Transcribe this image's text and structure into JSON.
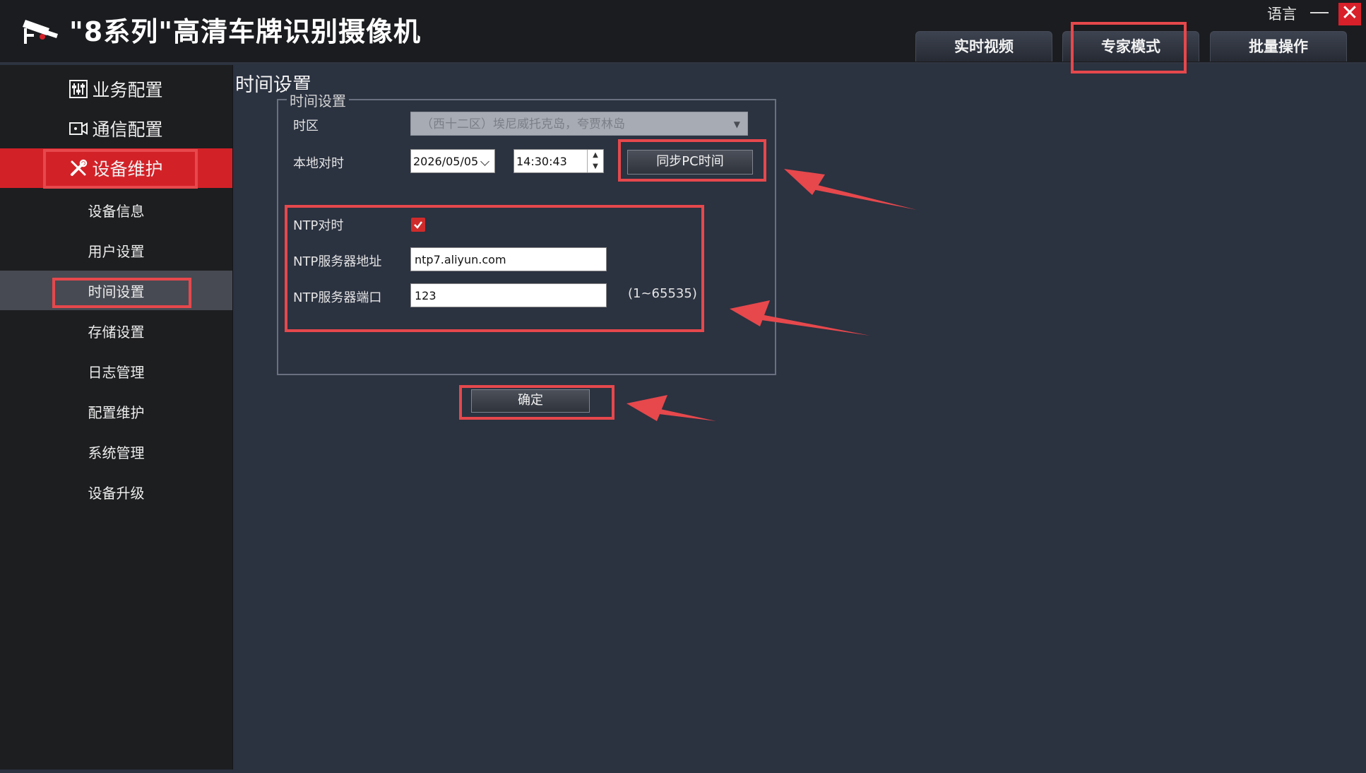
{
  "app": {
    "title": "\"8系列\"高清车牌识别摄像机",
    "language_label": "语言",
    "close_glyph": "✕"
  },
  "top_tabs": [
    {
      "label": "实时视频"
    },
    {
      "label": "专家模式"
    },
    {
      "label": "批量操作"
    }
  ],
  "sidebar": {
    "main_items": [
      {
        "label": "业务配置",
        "icon": "sliders-icon"
      },
      {
        "label": "通信配置",
        "icon": "camera-icon"
      },
      {
        "label": "设备维护",
        "icon": "tools-icon",
        "active": true
      }
    ],
    "sub_items": [
      {
        "label": "设备信息"
      },
      {
        "label": "用户设置"
      },
      {
        "label": "时间设置",
        "active": true
      },
      {
        "label": "存储设置"
      },
      {
        "label": "日志管理"
      },
      {
        "label": "配置维护"
      },
      {
        "label": "系统管理"
      },
      {
        "label": "设备升级"
      }
    ]
  },
  "main": {
    "page_title": "时间设置",
    "group_title": "时间设置",
    "timezone": {
      "label": "时区",
      "value": "（西十二区）埃尼威托克岛，夸贾林岛"
    },
    "local_time": {
      "label": "本地对时",
      "date": "2026/05/05",
      "time": "14:30:43",
      "sync_button": "同步PC时间"
    },
    "ntp": {
      "enable_label": "NTP对时",
      "enabled": true,
      "server_label": "NTP服务器地址",
      "server_value": "ntp7.aliyun.com",
      "port_label": "NTP服务器端口",
      "port_value": "123",
      "port_hint": "(1~65535)"
    },
    "confirm_button": "确定"
  },
  "colors": {
    "accent_red": "#d32128",
    "annotation_red": "#e6484c",
    "background": "#2b3240",
    "sidebar": "#1d1e20"
  }
}
